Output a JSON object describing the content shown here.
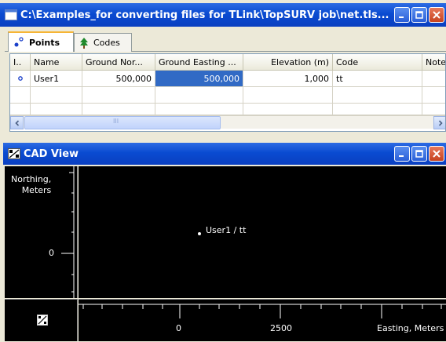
{
  "points_window": {
    "title": "C:\\Examples_for converting files for TLink\\TopSURV job\\net.tls...",
    "tabs": [
      "Points",
      "Codes"
    ],
    "columns": [
      "I..",
      "Name",
      "Ground Nor...",
      "Ground Easting ...",
      "Elevation (m)",
      "Code",
      "Note"
    ],
    "rows": [
      {
        "name": "User1",
        "northing": "500,000",
        "easting": "500,000",
        "elevation": "1,000",
        "code": "tt",
        "note": ""
      }
    ],
    "scroll_mid_glyph": "III"
  },
  "cad_window": {
    "title": "CAD View",
    "y_axis_label": "Northing,\nMeters",
    "y_tick": "0",
    "x_ticks": [
      "0",
      "2500"
    ],
    "x_axis_label": "Easting, Meters",
    "point_label": "User1 / tt"
  },
  "colors": {
    "title_bar": "#0a4bd1",
    "selection": "#316ac5",
    "cad_background": "#000000"
  },
  "icons": [
    "points-tab-icon",
    "codes-tree-icon",
    "minimize-icon",
    "maximize-icon",
    "close-icon",
    "cad-view-icon",
    "cad-corner-icon"
  ]
}
